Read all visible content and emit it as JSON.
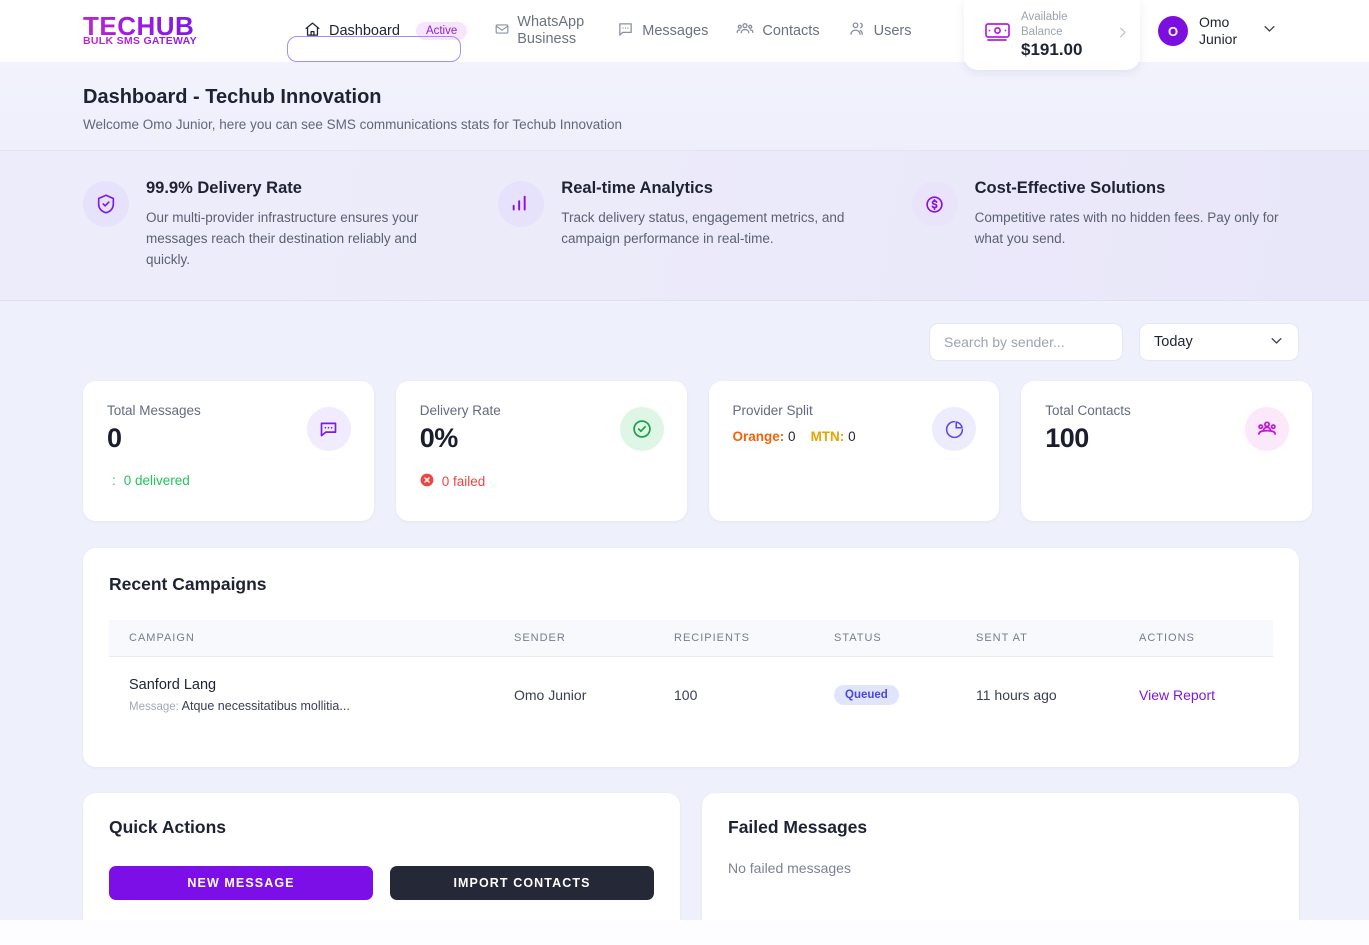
{
  "brand": {
    "name": "TECHUB",
    "tagline": "BULK SMS GATEWAY",
    "accent": "#7c0fe8"
  },
  "nav": {
    "items": [
      {
        "label": "Dashboard",
        "icon": "home-icon",
        "badge": "Active",
        "active": true
      },
      {
        "label": "WhatsApp Business",
        "icon": "mail-icon",
        "active": false
      },
      {
        "label": "Messages",
        "icon": "chat-icon",
        "active": false
      },
      {
        "label": "Contacts",
        "icon": "contacts-icon",
        "active": false
      },
      {
        "label": "Users",
        "icon": "users-icon",
        "active": false
      }
    ]
  },
  "balance": {
    "label": "Available Balance",
    "amount": "$191.00",
    "icon": "banknote-icon",
    "chevron": "chevron-right-icon"
  },
  "user": {
    "initial": "O",
    "name": "Omo Junior",
    "chevron": "chevron-down-icon"
  },
  "header": {
    "title": "Dashboard - Techub Innovation",
    "subtitle": "Welcome Omo Junior, here you can see SMS communications stats for Techub Innovation"
  },
  "features": [
    {
      "icon": "shield-check-icon",
      "title": "99.9% Delivery Rate",
      "desc": "Our multi-provider infrastructure ensures your messages reach their destination reliably and quickly."
    },
    {
      "icon": "bar-chart-icon",
      "title": "Real-time Analytics",
      "desc": "Track delivery status, engagement metrics, and campaign performance in real-time."
    },
    {
      "icon": "dollar-circle-icon",
      "title": "Cost-Effective Solutions",
      "desc": "Competitive rates with no hidden fees. Pay only for what you send."
    }
  ],
  "controls": {
    "search_placeholder": "Search by sender...",
    "search_value": "",
    "range_selected": "Today"
  },
  "stats": [
    {
      "label": "Total Messages",
      "value": "0",
      "icon": "message-bubble-icon",
      "foot_glyph": ":",
      "foot": "0 delivered",
      "foot_color": "#22c55e"
    },
    {
      "label": "Delivery Rate",
      "value": "0%",
      "icon": "check-circle-icon",
      "foot_glyph": "x-circle-icon",
      "foot": "0 failed",
      "foot_color": "#ef4444"
    },
    {
      "label": "Provider Split",
      "icon": "pie-chart-icon",
      "orange_label": "Orange:",
      "orange_value": "0",
      "mtn_label": "MTN:",
      "mtn_value": "0"
    },
    {
      "label": "Total Contacts",
      "value": "100",
      "icon": "group-icon"
    }
  ],
  "campaigns": {
    "title": "Recent Campaigns",
    "columns": [
      "CAMPAIGN",
      "SENDER",
      "RECIPIENTS",
      "STATUS",
      "SENT AT",
      "ACTIONS"
    ],
    "rows": [
      {
        "name": "Sanford Lang",
        "message_label": "Message:",
        "message": "Atque necessitatibus mollitia...",
        "sender": "Omo Junior",
        "recipients": "100",
        "status": "Queued",
        "sent_at": "11 hours ago",
        "action": "View Report"
      }
    ]
  },
  "quick_actions": {
    "title": "Quick Actions",
    "new_message": "NEW MESSAGE",
    "import_contacts": "IMPORT CONTACTS"
  },
  "failed": {
    "title": "Failed Messages",
    "empty": "No failed messages"
  }
}
